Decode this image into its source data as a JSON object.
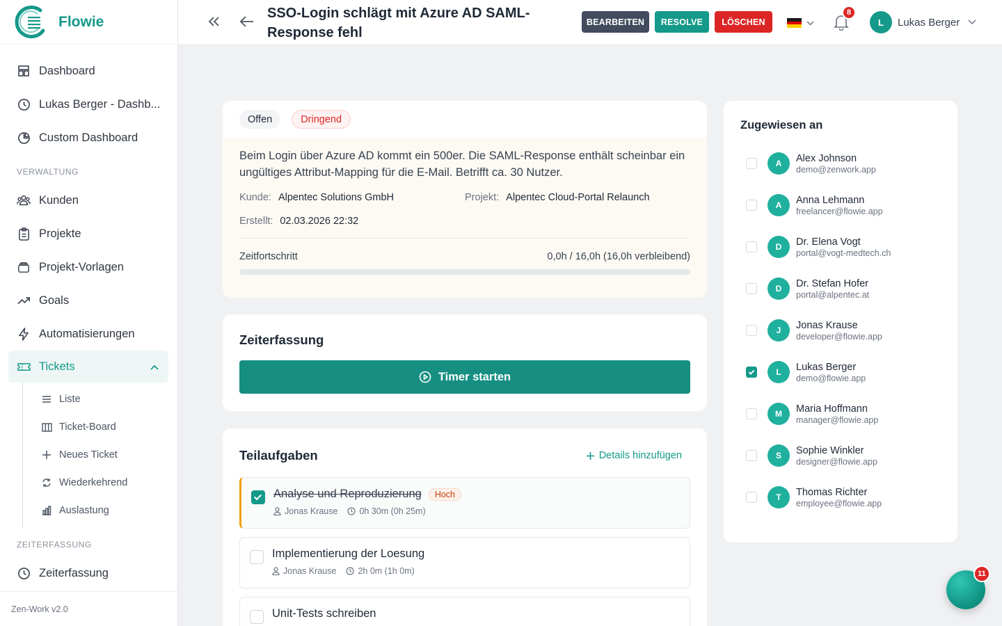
{
  "app": {
    "name": "Flowie",
    "version": "Zen-Work v2.0"
  },
  "sidebar": {
    "items": [
      {
        "label": "Dashboard",
        "icon": "dashboard-icon"
      },
      {
        "label": "Lukas Berger - Dashb...",
        "icon": "clock-icon"
      },
      {
        "label": "Custom Dashboard",
        "icon": "pie-chart-icon"
      }
    ],
    "section_admin": "VERWALTUNG",
    "admin_items": [
      {
        "label": "Kunden",
        "icon": "users-icon"
      },
      {
        "label": "Projekte",
        "icon": "clipboard-icon"
      },
      {
        "label": "Projekt-Vorlagen",
        "icon": "layers-icon"
      },
      {
        "label": "Goals",
        "icon": "trending-up-icon"
      },
      {
        "label": "Automatisierungen",
        "icon": "lightning-icon"
      },
      {
        "label": "Tickets",
        "icon": "ticket-icon"
      }
    ],
    "tickets_sub": [
      {
        "label": "Liste"
      },
      {
        "label": "Ticket-Board"
      },
      {
        "label": "Neues Ticket"
      },
      {
        "label": "Wiederkehrend"
      },
      {
        "label": "Auslastung"
      }
    ],
    "section_time": "ZEITERFASSUNG",
    "time_items": [
      {
        "label": "Zeiterfassung",
        "icon": "clock-icon"
      }
    ]
  },
  "header": {
    "title": "SSO-Login schlägt mit Azure AD SAML-Response fehl",
    "edit_label": "BEARBEITEN",
    "resolve_label": "RESOLVE",
    "delete_label": "LÖSCHEN",
    "notification_count": "8",
    "user_initial": "L",
    "user_name": "Lukas Berger"
  },
  "ticket": {
    "status": "Offen",
    "priority": "Dringend",
    "description": "Beim Login über Azure AD kommt ein 500er. Die SAML-Response enthält scheinbar ein ungültiges Attribut-Mapping für die E-Mail. Betrifft ca. 30 Nutzer.",
    "customer_label": "Kunde:",
    "customer": "Alpentec Solutions GmbH",
    "project_label": "Projekt:",
    "project": "Alpentec Cloud-Portal Relaunch",
    "created_label": "Erstellt:",
    "created": "02.03.2026 22:32",
    "progress_label": "Zeitfortschritt",
    "progress_text": "0,0h / 16,0h (16,0h verbleibend)",
    "progress_fraction": 0
  },
  "time_tracking": {
    "title": "Zeiterfassung",
    "timer_label": "Timer starten"
  },
  "subtasks": {
    "title": "Teilaufgaben",
    "add_label": "Details hinzufügen",
    "items": [
      {
        "title": "Analyse und Reproduzierung",
        "done": true,
        "priority": "Hoch",
        "assignee": "Jonas Krause",
        "time": "0h 30m (0h 25m)"
      },
      {
        "title": "Implementierung der Loesung",
        "done": false,
        "priority": "",
        "assignee": "Jonas Krause",
        "time": "2h 0m (1h 0m)"
      },
      {
        "title": "Unit-Tests schreiben",
        "done": false,
        "priority": "",
        "assignee": "",
        "time": ""
      }
    ]
  },
  "assigned": {
    "title": "Zugewiesen an",
    "people": [
      {
        "initial": "A",
        "name": "Alex Johnson",
        "email": "demo@zenwork.app",
        "checked": false
      },
      {
        "initial": "A",
        "name": "Anna Lehmann",
        "email": "freelancer@flowie.app",
        "checked": false
      },
      {
        "initial": "D",
        "name": "Dr. Elena Vogt",
        "email": "portal@vogt-medtech.ch",
        "checked": false
      },
      {
        "initial": "D",
        "name": "Dr. Stefan Hofer",
        "email": "portal@alpentec.at",
        "checked": false
      },
      {
        "initial": "J",
        "name": "Jonas Krause",
        "email": "developer@flowie.app",
        "checked": false
      },
      {
        "initial": "L",
        "name": "Lukas Berger",
        "email": "demo@flowie.app",
        "checked": true
      },
      {
        "initial": "M",
        "name": "Maria Hoffmann",
        "email": "manager@flowie.app",
        "checked": false
      },
      {
        "initial": "S",
        "name": "Sophie Winkler",
        "email": "designer@flowie.app",
        "checked": false
      },
      {
        "initial": "T",
        "name": "Thomas Richter",
        "email": "employee@flowie.app",
        "checked": false
      }
    ]
  },
  "chat": {
    "badge_count": "11"
  },
  "colors": {
    "accent": "#14998a",
    "danger": "#dc2626",
    "dark": "#424c5e"
  }
}
